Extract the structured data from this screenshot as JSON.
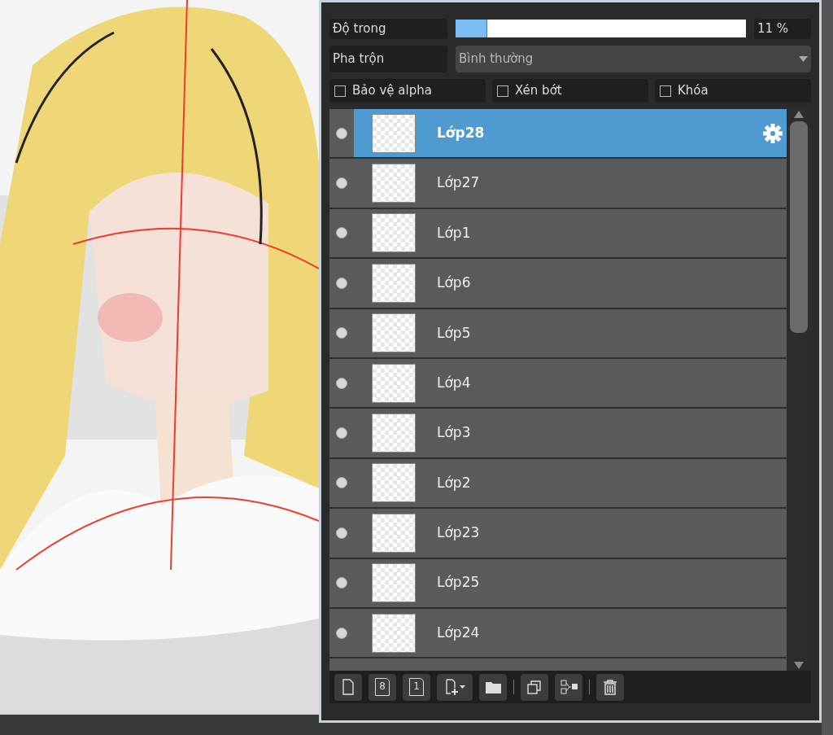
{
  "opacity": {
    "label": "Độ trong",
    "level": 0.11,
    "reading": "11 %"
  },
  "blend": {
    "label": "Pha trộn",
    "value": "Bình thường"
  },
  "options": [
    {
      "label": "Bảo vệ alpha",
      "checked": false
    },
    {
      "label": "Xén bớt",
      "checked": false
    },
    {
      "label": "Khóa",
      "checked": false
    }
  ],
  "layers": [
    {
      "name": "Lớp28",
      "selected": true
    },
    {
      "name": "Lớp27",
      "selected": false
    },
    {
      "name": "Lớp1",
      "selected": false
    },
    {
      "name": "Lớp6",
      "selected": false
    },
    {
      "name": "Lớp5",
      "selected": false
    },
    {
      "name": "Lớp4",
      "selected": false
    },
    {
      "name": "Lớp3",
      "selected": false
    },
    {
      "name": "Lớp2",
      "selected": false
    },
    {
      "name": "Lớp23",
      "selected": false
    },
    {
      "name": "Lớp25",
      "selected": false
    },
    {
      "name": "Lớp24",
      "selected": false
    }
  ],
  "toolbar": [
    {
      "kind": "new"
    },
    {
      "kind": "digit",
      "glyph": "8"
    },
    {
      "kind": "digit",
      "glyph": "1"
    },
    {
      "kind": "add-menu"
    },
    {
      "kind": "folder"
    },
    {
      "kind": "sep"
    },
    {
      "kind": "duplicate"
    },
    {
      "kind": "merge"
    },
    {
      "kind": "sep"
    },
    {
      "kind": "trash"
    }
  ]
}
